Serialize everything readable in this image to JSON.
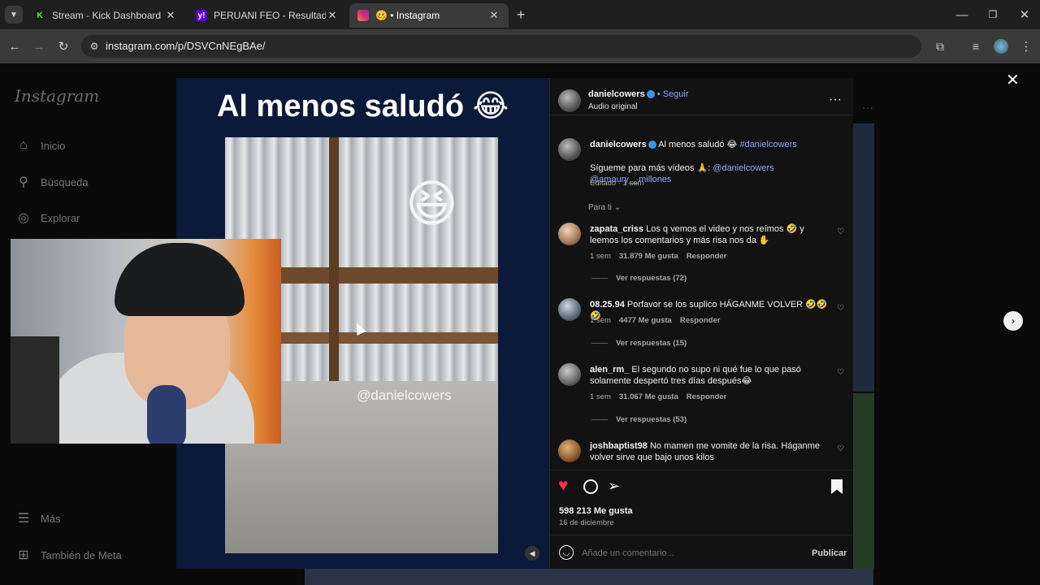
{
  "browser": {
    "tabs": [
      {
        "title": "Stream - Kick Dashboard",
        "favicon": "K",
        "favicon_color": "#53fc18",
        "active": false
      },
      {
        "title": "PERUANI FEO - Resultados de Y",
        "favicon": "y!",
        "favicon_color": "#6001d2",
        "active": false
      },
      {
        "title": "🥴 • Instagram",
        "favicon": "ig",
        "favicon_color": "#e1306c",
        "active": true
      }
    ],
    "new_tab": "+",
    "url": "instagram.com/p/DSVCnNEgBAe/"
  },
  "sidebar": {
    "logo": "Instagram",
    "items": [
      {
        "label": "Inicio",
        "icon": "home-icon"
      },
      {
        "label": "Búsqueda",
        "icon": "search-icon"
      },
      {
        "label": "Explorar",
        "icon": "compass-icon"
      },
      {
        "label": "Más",
        "icon": "menu-icon"
      },
      {
        "label": "También de Meta",
        "icon": "grid-icon"
      }
    ]
  },
  "media": {
    "headline": "Al menos saludó 😂",
    "watermark": "@danielcowers"
  },
  "post": {
    "author": "danielcowers",
    "follow": "Seguir",
    "audio": "Audio original",
    "caption": {
      "text": "Al menos saludó 😂",
      "hashtag": "#danielcowers",
      "line2": "Sígueme para más vídeos 🙏:",
      "mention1": "@danielcowers",
      "mention2": "@amaury__millones",
      "edited": "Editado · 1 sem"
    },
    "sort": "Para ti",
    "comments": [
      {
        "user": "zapata_criss",
        "text": "Los q vemos el video y nos reímos 🤣 y leemos los comentarios y más risa nos da ✋",
        "time": "1 sem",
        "likes": "31.879 Me gusta",
        "reply": "Responder",
        "replies": "Ver respuestas (72)"
      },
      {
        "user": "08.25.94",
        "text": "Porfavor se los suplico HÁGANME VOLVER 🤣🤣🤣",
        "time": "1 sem",
        "likes": "4477 Me gusta",
        "reply": "Responder",
        "replies": "Ver respuestas (15)"
      },
      {
        "user": "alen_rm_",
        "text": "El segundo no supo ni qué fue lo que pasó solamente despertó tres días después😂",
        "time": "1 sem",
        "likes": "31.067 Me gusta",
        "reply": "Responder",
        "replies": "Ver respuestas (53)"
      },
      {
        "user": "joshbaptist98",
        "text": "No mamen me vomite de la risa. Háganme volver sirve que bajo unos kilos",
        "time": "",
        "likes": "",
        "reply": "",
        "replies": ""
      }
    ],
    "likes": "598 213 Me gusta",
    "date": "16 de diciembre",
    "comment_placeholder": "Añade un comentario...",
    "publish": "Publicar"
  },
  "colors": {
    "like": "#ff3040",
    "accent": "#8fa6ff",
    "verified": "#3897f0"
  }
}
